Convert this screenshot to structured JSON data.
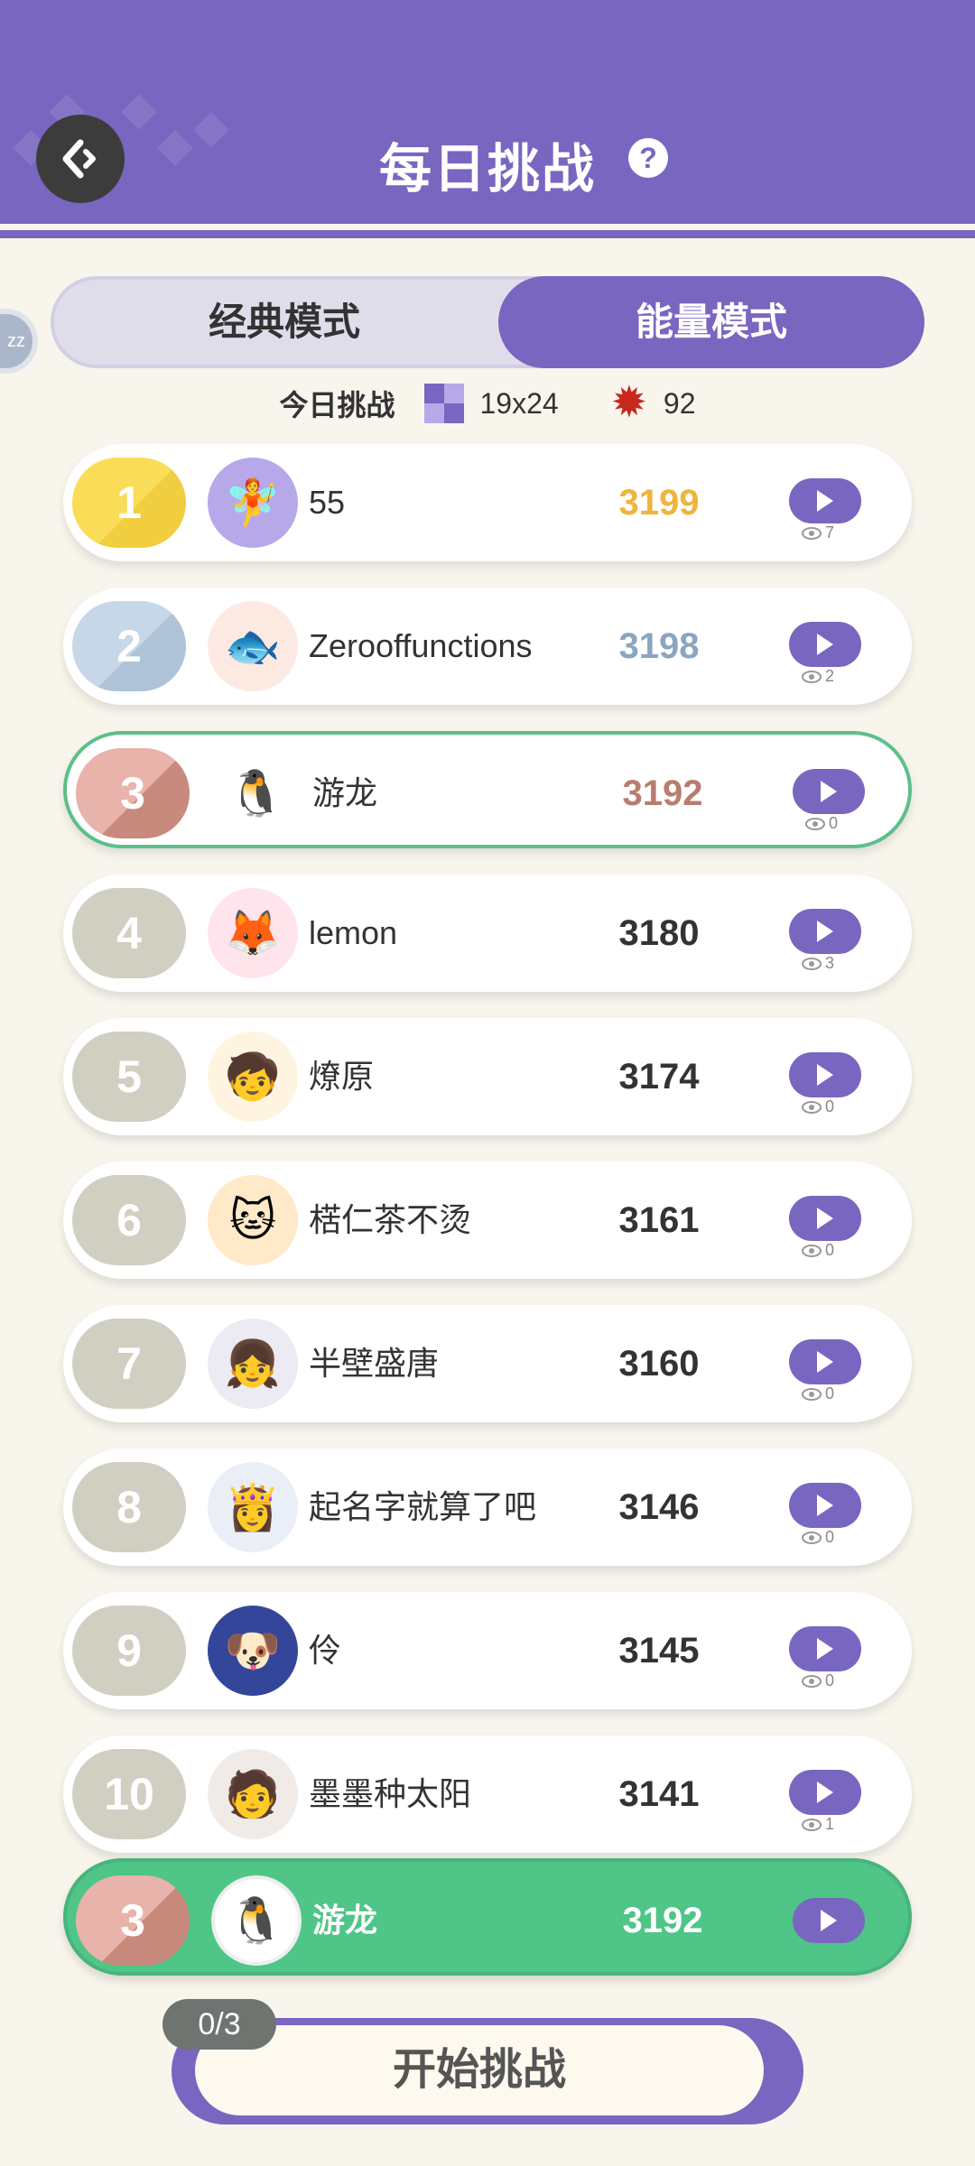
{
  "header": {
    "title": "每日挑战",
    "back_icon": "back-arrow-icon",
    "help_glyph": "?",
    "side_avatar_text": "zz"
  },
  "modes": {
    "classic": "经典模式",
    "energy": "能量模式",
    "active": "energy"
  },
  "challenge": {
    "label": "今日挑战",
    "grid_size": "19x24",
    "star_count": "92"
  },
  "leaderboard": [
    {
      "rank": "1",
      "name": "55",
      "score": "3199",
      "views": "7",
      "avatar": "🧚"
    },
    {
      "rank": "2",
      "name": "Zerooffunctions",
      "score": "3198",
      "views": "2",
      "avatar": "🐟"
    },
    {
      "rank": "3",
      "name": "游龙",
      "score": "3192",
      "views": "0",
      "avatar": "🐧"
    },
    {
      "rank": "4",
      "name": "lemon",
      "score": "3180",
      "views": "3",
      "avatar": "🦊"
    },
    {
      "rank": "5",
      "name": "燎原",
      "score": "3174",
      "views": "0",
      "avatar": "🧒"
    },
    {
      "rank": "6",
      "name": "楛仁茶不烫",
      "score": "3161",
      "views": "0",
      "avatar": "🐱"
    },
    {
      "rank": "7",
      "name": "半壁盛唐",
      "score": "3160",
      "views": "0",
      "avatar": "👧"
    },
    {
      "rank": "8",
      "name": "起名字就算了吧",
      "score": "3146",
      "views": "0",
      "avatar": "👸"
    },
    {
      "rank": "9",
      "name": "伶",
      "score": "3145",
      "views": "0",
      "avatar": "🐶"
    },
    {
      "rank": "10",
      "name": "墨墨种太阳",
      "score": "3141",
      "views": "1",
      "avatar": "🧑"
    }
  ],
  "me": {
    "rank": "3",
    "name": "游龙",
    "score": "3192",
    "avatar": "🐧"
  },
  "start": {
    "label": "开始挑战",
    "attempts": "0/3"
  },
  "colors": {
    "primary": "#7966c0",
    "highlight": "#4fc587",
    "background": "#f8f5ec"
  }
}
